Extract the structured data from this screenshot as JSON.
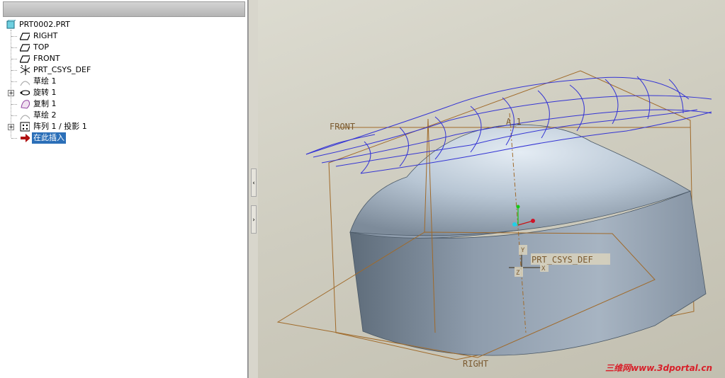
{
  "tree": {
    "root": "PRT0002.PRT",
    "items": [
      {
        "label": "RIGHT",
        "icon": "datum-plane-icon"
      },
      {
        "label": "TOP",
        "icon": "datum-plane-icon"
      },
      {
        "label": "FRONT",
        "icon": "datum-plane-icon"
      },
      {
        "label": "PRT_CSYS_DEF",
        "icon": "coordinate-system-icon"
      },
      {
        "label": "草绘 1",
        "icon": "sketch-icon"
      },
      {
        "label": "旋转 1",
        "icon": "revolve-icon"
      },
      {
        "label": "复制 1",
        "icon": "copy-surface-icon"
      },
      {
        "label": "草绘 2",
        "icon": "sketch-icon"
      },
      {
        "label": "阵列 1 / 投影 1",
        "icon": "pattern-icon"
      },
      {
        "label": "在此插入",
        "icon": "insert-here-arrow-icon"
      }
    ]
  },
  "viewport": {
    "labels": {
      "front": "FRONT",
      "axis": "A_1",
      "csys": "PRT_CSYS_DEF",
      "right": "RIGHT",
      "y": "Y",
      "x": "X",
      "z": "Z"
    },
    "watermark": "三维网www.3dportal.cn"
  },
  "colors": {
    "datum": "#9a6a30",
    "curves": "#3a3ad8",
    "body": "#aebccb",
    "insert_highlight": "#2b6fb8"
  }
}
